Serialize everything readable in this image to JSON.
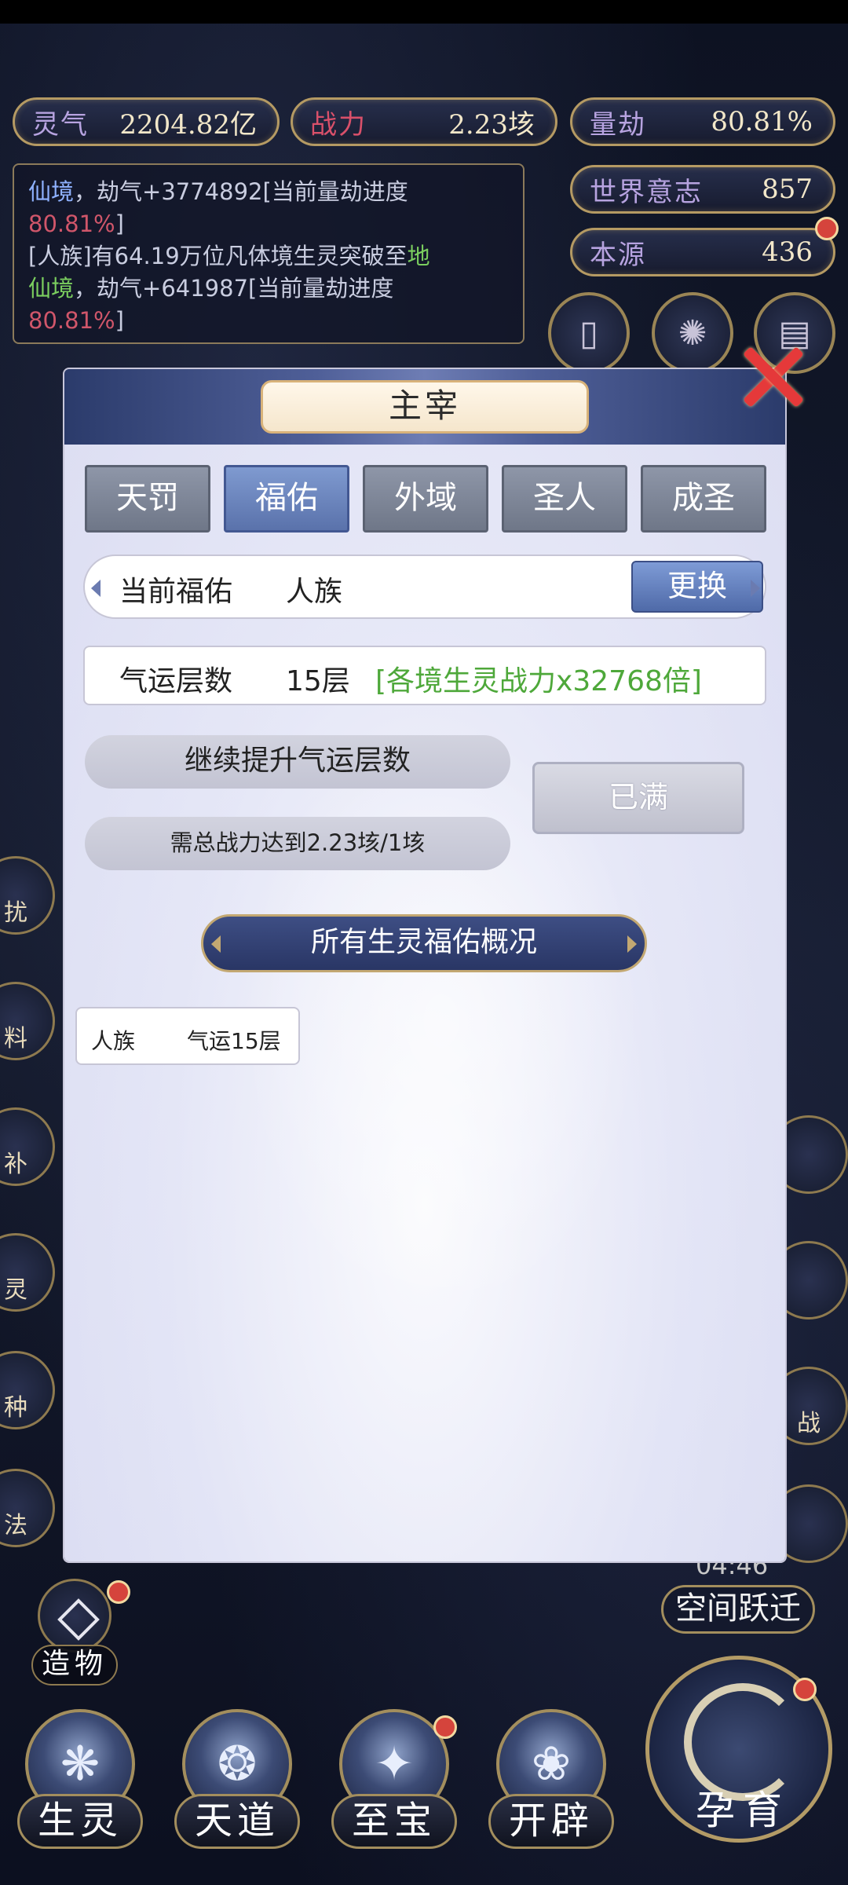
{
  "stats": {
    "lingqi_label": "灵气",
    "lingqi_value": "2204.82亿",
    "zhanli_label": "战力",
    "zhanli_value": "2.23垓",
    "liangjie_label": "量劫",
    "liangjie_value": "80.81%",
    "shijie_label": "世界意志",
    "shijie_value": "857",
    "benyuan_label": "本源",
    "benyuan_value": "436"
  },
  "log": {
    "line1_blue": "仙境",
    "line1_text": "，劫气+3774892[当前量劫进度",
    "line1_red": "80.81%",
    "line1_end": "]",
    "line2_text": "[人族]有64.19万位凡体境生灵突破至",
    "line2_green": "地",
    "line3_green": "仙境",
    "line3_text": "，劫气+641987[当前量劫进度",
    "line3_red": "80.81%",
    "line3_end": "]"
  },
  "side_left": [
    "扰",
    "料",
    "补",
    "灵",
    "种",
    "法"
  ],
  "side_right": [
    "战"
  ],
  "dialog": {
    "title": "主宰",
    "tabs": [
      "天罚",
      "福佑",
      "外域",
      "圣人",
      "成圣"
    ],
    "active_tab": 1,
    "current_label": "当前福佑",
    "current_value": "人族",
    "swap_button": "更换",
    "fortune_label": "气运层数",
    "fortune_value": "15层",
    "fortune_bonus": "[各境生灵战力x32768倍]",
    "continue_label": "继续提升气运层数",
    "need_label": "需总战力达到2.23垓/1垓",
    "full_button": "已满",
    "overview_title": "所有生灵福佑概况",
    "races": [
      {
        "name": "人族",
        "info": "气运15层"
      }
    ]
  },
  "timer": "04:46",
  "space_jump": "空间跃迁",
  "zaowu": "造物",
  "bottom_nav": [
    "生灵",
    "天道",
    "至宝",
    "开辟"
  ],
  "big_button": "孕育",
  "colors": {
    "accent_gold": "#b59a63",
    "panel_blue": "#4f5f98",
    "green_text": "#4ea83a",
    "red_text": "#d0566a"
  }
}
